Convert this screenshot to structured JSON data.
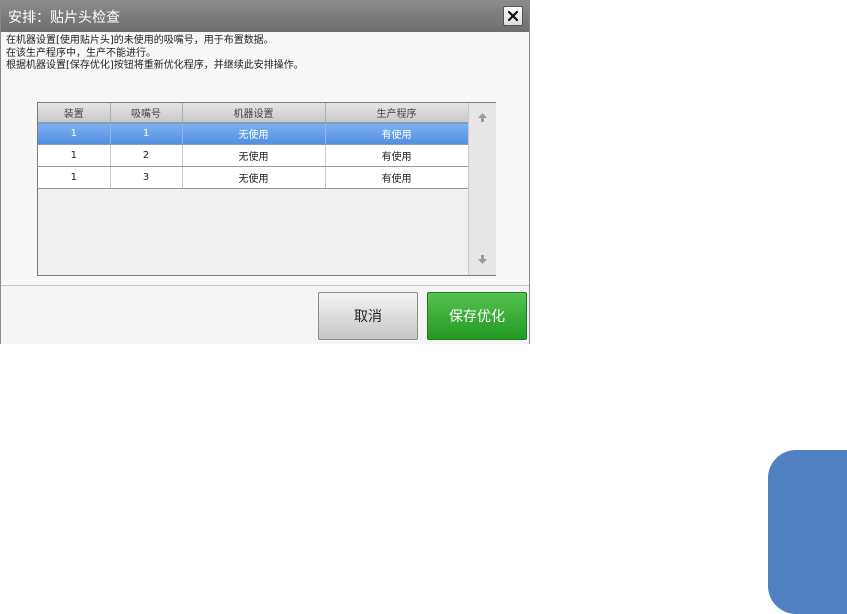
{
  "dialog": {
    "title": "安排：贴片头检查",
    "messages": [
      "在机器设置[使用贴片头]的未使用的吸嘴号，用于布置数据。",
      "在该生产程序中，生产不能进行。",
      "根据机器设置[保存优化]按钮将重新优化程序，并继续此安排操作。"
    ],
    "table": {
      "columns": [
        "装置",
        "吸嘴号",
        "机器设置",
        "生产程序"
      ],
      "rows": [
        [
          "1",
          "1",
          "无使用",
          "有使用"
        ],
        [
          "1",
          "2",
          "无使用",
          "有使用"
        ],
        [
          "1",
          "3",
          "无使用",
          "有使用"
        ]
      ],
      "selected_row": 0
    },
    "buttons": {
      "cancel": "取消",
      "save_optimize": "保存优化"
    }
  },
  "icons": {
    "close": "close-icon",
    "scroll_up": "arrow-up-icon",
    "scroll_down": "arrow-down-icon"
  },
  "colors": {
    "title_bar": "#7a7a7a",
    "selected_row": "#5b98e6",
    "save_button": "#2fa52f",
    "side_tab": "#4f80bf"
  }
}
